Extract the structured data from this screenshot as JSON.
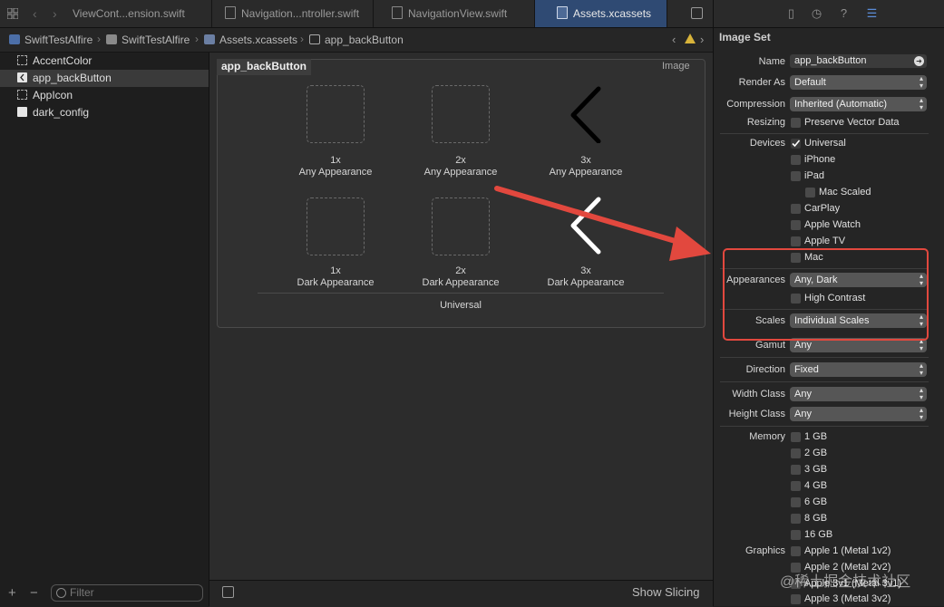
{
  "tabs": [
    {
      "label": "ViewCont...ension.swift"
    },
    {
      "label": "Navigation...ntroller.swift"
    },
    {
      "label": "NavigationView.swift"
    },
    {
      "label": "Assets.xcassets"
    }
  ],
  "breadcrumb": [
    "SwiftTestAlfire",
    "SwiftTestAlfire",
    "Assets.xcassets",
    "app_backButton"
  ],
  "assets": [
    {
      "label": "AccentColor"
    },
    {
      "label": "app_backButton"
    },
    {
      "label": "AppIcon"
    },
    {
      "label": "dark_config"
    }
  ],
  "filter_placeholder": "Filter",
  "image_set": {
    "name": "app_backButton",
    "type": "Image",
    "slots": [
      {
        "scale": "1x",
        "appearance": "Any Appearance"
      },
      {
        "scale": "2x",
        "appearance": "Any Appearance"
      },
      {
        "scale": "3x",
        "appearance": "Any Appearance"
      },
      {
        "scale": "1x",
        "appearance": "Dark Appearance"
      },
      {
        "scale": "2x",
        "appearance": "Dark Appearance"
      },
      {
        "scale": "3x",
        "appearance": "Dark Appearance"
      }
    ],
    "group_label": "Universal"
  },
  "show_slicing": "Show Slicing",
  "inspector": {
    "title": "Image Set",
    "name_label": "Name",
    "name_value": "app_backButton",
    "render_as_label": "Render As",
    "render_as_value": "Default",
    "compression_label": "Compression",
    "compression_value": "Inherited (Automatic)",
    "resizing_label": "Resizing",
    "resizing_option": "Preserve Vector Data",
    "devices_label": "Devices",
    "devices": [
      {
        "label": "Universal",
        "checked": true
      },
      {
        "label": "iPhone",
        "checked": false
      },
      {
        "label": "iPad",
        "checked": false
      },
      {
        "label": "Mac Scaled",
        "checked": false
      },
      {
        "label": "CarPlay",
        "checked": false
      },
      {
        "label": "Apple Watch",
        "checked": false
      },
      {
        "label": "Apple TV",
        "checked": false
      },
      {
        "label": "Mac",
        "checked": false
      }
    ],
    "appearances_label": "Appearances",
    "appearances_value": "Any, Dark",
    "high_contrast": "High Contrast",
    "scales_label": "Scales",
    "scales_value": "Individual Scales",
    "gamut_label": "Gamut",
    "gamut_value": "Any",
    "direction_label": "Direction",
    "direction_value": "Fixed",
    "width_class_label": "Width Class",
    "width_class_value": "Any",
    "height_class_label": "Height Class",
    "height_class_value": "Any",
    "memory_label": "Memory",
    "memory": [
      "1 GB",
      "2 GB",
      "3 GB",
      "4 GB",
      "6 GB",
      "8 GB",
      "16 GB"
    ],
    "graphics_label": "Graphics",
    "graphics": [
      "Apple 1 (Metal 1v2)",
      "Apple 2 (Metal 2v2)",
      "Apple 3v1 (Metal 3v1)",
      "Apple 3 (Metal 3v2)"
    ]
  },
  "watermark": "@稀土掘金技术社区",
  "colors": {
    "accent": "#2f4a73",
    "annotation": "#e2483e"
  }
}
